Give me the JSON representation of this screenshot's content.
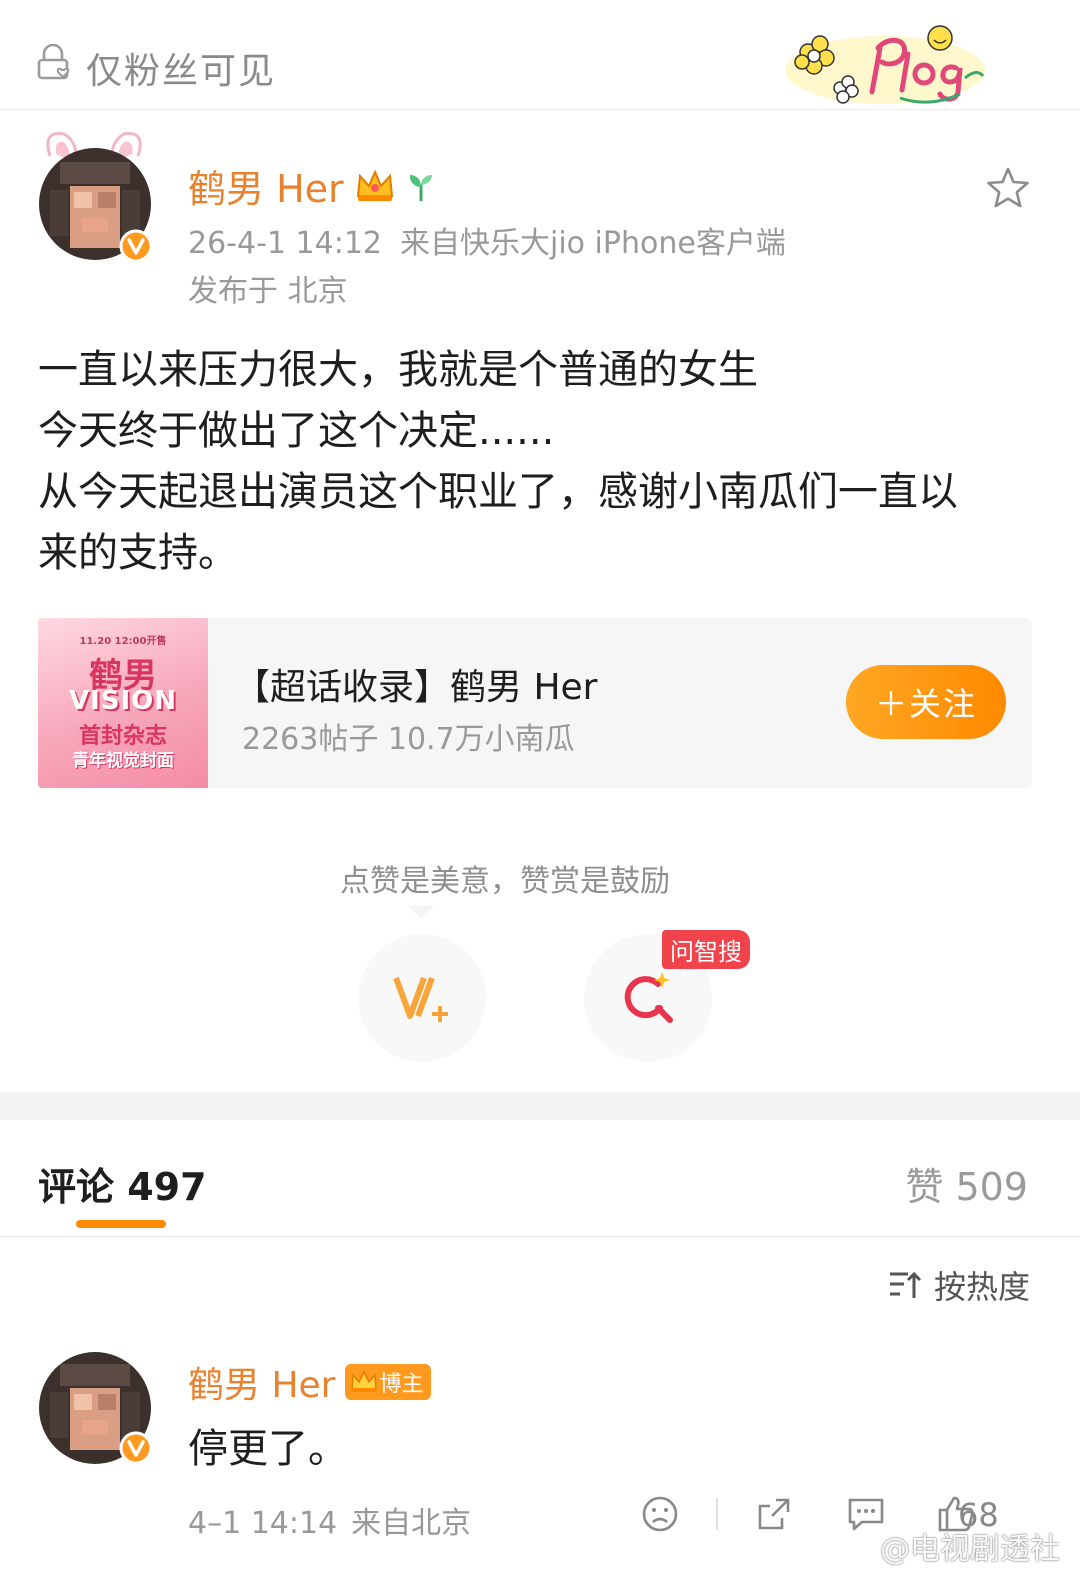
{
  "visibility": {
    "label": "仅粉丝可见"
  },
  "post": {
    "author": "鹤男 Her",
    "time": "26-4-1 14:12",
    "source": "来自快乐大jio iPhone客户端",
    "location": "发布于 北京",
    "body_lines": [
      "一直以来压力很大，我就是个普通的女生",
      "今天终于做出了这个决定......",
      "从今天起退出演员这个职业了，感谢小南瓜们一直以",
      "来的支持。"
    ]
  },
  "topic_card": {
    "title": "【超话收录】鹤男 Her",
    "stats": "2263帖子 10.7万小南瓜",
    "follow_label": "＋关注",
    "thumb_lines": [
      "11.20 12:00开售",
      "鹤男",
      "VISION",
      "首封杂志",
      "青年视觉封面"
    ]
  },
  "reward": {
    "text": "点赞是美意，赞赏是鼓励",
    "ai_badge": "问智搜"
  },
  "tabs": {
    "comments": "评论 497",
    "likes": "赞 509"
  },
  "sort": {
    "label": "按热度"
  },
  "comment": {
    "author": "鹤男 Her",
    "badge": "博主",
    "text": "停更了。",
    "time": "4–1 14:14",
    "source": "来自北京",
    "like_count": "68"
  },
  "watermark": "@电视剧透社",
  "colors": {
    "accent": "#ff8a00",
    "author": "#e8822f",
    "badge_red": "#f0434c"
  }
}
